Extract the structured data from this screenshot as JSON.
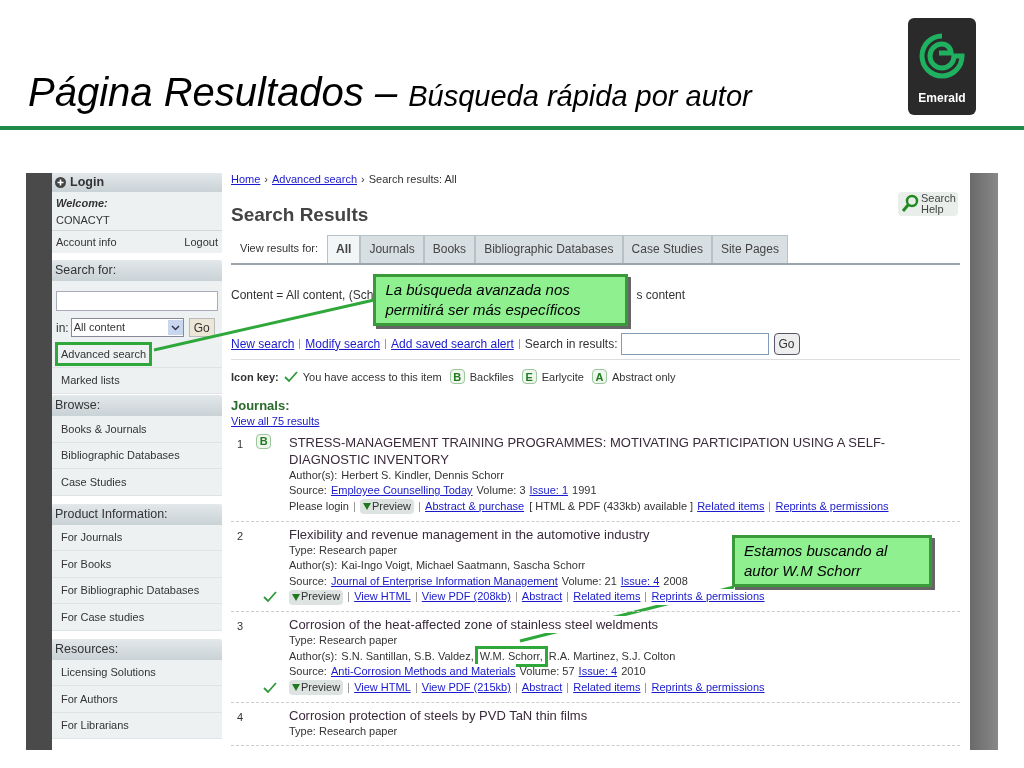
{
  "slide": {
    "title": "Página Resultados – ",
    "subtitle": "Búsqueda rápida por autor",
    "logo_text": "Emerald"
  },
  "sidebar": {
    "login": "Login",
    "welcome": "Welcome:",
    "user": "CONACYT",
    "account_links": [
      "Account info",
      "Logout"
    ],
    "search": {
      "header": "Search for:",
      "in_label": "in:",
      "select_value": "All content",
      "go": "Go"
    },
    "links": [
      {
        "label": "Advanced search",
        "highlighted": true
      },
      {
        "label": "Marked lists",
        "highlighted": false
      }
    ],
    "sections": [
      {
        "title": "Browse:",
        "items": [
          "Books & Journals",
          "Bibliographic Databases",
          "Case Studies"
        ]
      },
      {
        "title": "Product Information:",
        "items": [
          "For Journals",
          "For Books",
          "For Bibliographic Databases",
          "For Case studies"
        ]
      },
      {
        "title": "Resources:",
        "items": [
          "Licensing Solutions",
          "For Authors",
          "For Librarians"
        ]
      }
    ]
  },
  "main": {
    "breadcrumb": [
      {
        "kind": "link",
        "label": "Home"
      },
      {
        "kind": "sep",
        "label": "›"
      },
      {
        "kind": "link",
        "label": "Advanced search"
      },
      {
        "kind": "sep",
        "label": "›"
      },
      {
        "kind": "text",
        "label": "Search results: All"
      }
    ],
    "title": "Search Results",
    "help": "Search Help",
    "tabs_label": "View results for:",
    "tabs": [
      {
        "label": "All",
        "selected": true
      },
      {
        "label": "Journals",
        "selected": false
      },
      {
        "label": "Books",
        "selected": false
      },
      {
        "label": "Bibliographic Databases",
        "selected": false
      },
      {
        "label": "Case Studies",
        "selected": false
      },
      {
        "label": "Site Pages",
        "selected": false
      }
    ],
    "content_line": [
      "Content = All content, (Sch",
      "s content"
    ],
    "callouts": [
      "La búsqueda avanzada nos permitirá ser más específicos",
      "Estamos buscando al autor W.M Schorr"
    ],
    "actions": [
      "New search",
      "Modify search",
      "Add saved search alert"
    ],
    "search_in_label": "Search in results:",
    "go": "Go",
    "icon_key": {
      "label": "Icon key:",
      "items": [
        {
          "kind": "check",
          "label": "You have access to this item"
        },
        {
          "kind": "letter",
          "letter": "B",
          "label": "Backfiles"
        },
        {
          "kind": "letter",
          "letter": "E",
          "label": "Earlycite"
        },
        {
          "kind": "letter",
          "letter": "A",
          "label": "Abstract only"
        }
      ]
    },
    "section_title": "Journals:",
    "view_all": "View all 75 results",
    "results": [
      {
        "number": "1",
        "badge": "B",
        "access": false,
        "title": "STRESS-MANAGEMENT TRAINING PROGRAMMES: MOTIVATING PARTICIPATION USING A SELF-DIAGNOSTIC INVENTORY",
        "authors_label": "Author(s):",
        "authors": [
          {
            "name": "Herbert S. Kindler, Dennis Schorr",
            "highlighted": false
          }
        ],
        "source": {
          "label": "Source:",
          "journal": "Employee Counselling Today",
          "volume": "Volume: 3",
          "issue": "Issue: 1",
          "year": "1991"
        },
        "links": [
          {
            "kind": "text",
            "label": "Please login"
          },
          {
            "kind": "preview",
            "label": "Preview"
          },
          {
            "kind": "link",
            "label": "Abstract & purchase"
          },
          {
            "kind": "note",
            "label": "[ HTML & PDF (433kb) available ]"
          },
          {
            "kind": "link",
            "label": "Related items"
          },
          {
            "kind": "link",
            "label": "Reprints & permissions"
          }
        ]
      },
      {
        "number": "2",
        "access": true,
        "title": "Flexibility and revenue management in the automotive industry",
        "type": "Type: Research paper",
        "authors_label": "Author(s):",
        "authors": [
          {
            "name": "Kai-Ingo Voigt, Michael Saatmann, Sascha Schorr",
            "highlighted": false
          }
        ],
        "source": {
          "label": "Source:",
          "journal": "Journal of Enterprise Information Management",
          "volume": "Volume: 21",
          "issue": "Issue: 4",
          "year": "2008"
        },
        "links": [
          {
            "kind": "preview",
            "label": "Preview"
          },
          {
            "kind": "link",
            "label": "View HTML"
          },
          {
            "kind": "link",
            "label": "View PDF (208kb)"
          },
          {
            "kind": "link",
            "label": "Abstract"
          },
          {
            "kind": "link",
            "label": "Related items"
          },
          {
            "kind": "link",
            "label": "Reprints & permissions"
          }
        ]
      },
      {
        "number": "3",
        "access": true,
        "title": "Corrosion of the heat-affected zone of stainless steel weldments",
        "type": "Type: Research paper",
        "authors_label": "Author(s):",
        "authors": [
          {
            "name": "S.N. Santillan, S.B. Valdez,",
            "highlighted": false
          },
          {
            "name": "W.M. Schorr,",
            "highlighted": true
          },
          {
            "name": "R.A. Martinez, S.J. Colton",
            "highlighted": false
          }
        ],
        "source": {
          "label": "Source:",
          "journal": "Anti-Corrosion Methods and Materials",
          "volume": "Volume: 57",
          "issue": "Issue: 4",
          "year": "2010"
        },
        "links": [
          {
            "kind": "preview",
            "label": "Preview"
          },
          {
            "kind": "link",
            "label": "View HTML"
          },
          {
            "kind": "link",
            "label": "View PDF (215kb)"
          },
          {
            "kind": "link",
            "label": "Abstract"
          },
          {
            "kind": "link",
            "label": "Related items"
          },
          {
            "kind": "link",
            "label": "Reprints & permissions"
          }
        ]
      },
      {
        "number": "4",
        "access": false,
        "title": "Corrosion protection of steels by PVD TaN thin films",
        "type": "Type: Research paper"
      }
    ]
  }
}
